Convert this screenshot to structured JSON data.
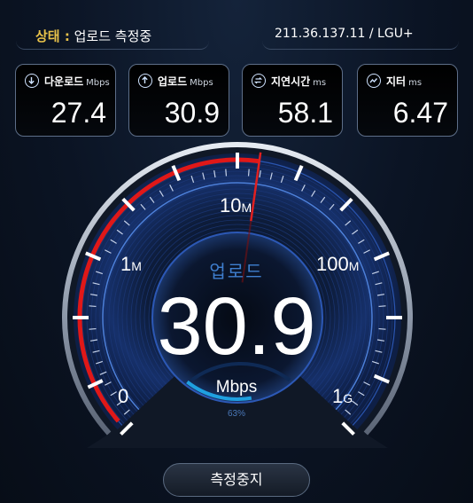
{
  "status": {
    "label": "상태 :",
    "text": "업로드 측정중"
  },
  "connection": {
    "ip_isp": "211.36.137.11 / LGU+"
  },
  "cards": [
    {
      "title": "다운로드",
      "unit": "Mbps",
      "value": "27.4",
      "icon": "download-icon"
    },
    {
      "title": "업로드",
      "unit": "Mbps",
      "value": "30.9",
      "icon": "upload-icon"
    },
    {
      "title": "지연시간",
      "unit": "ms",
      "value": "58.1",
      "icon": "latency-icon"
    },
    {
      "title": "지터",
      "unit": "ms",
      "value": "6.47",
      "icon": "jitter-icon"
    }
  ],
  "gauge": {
    "mode": "업로드",
    "speed": "30.9",
    "speed_unit": "Mbps",
    "progress_text": "63%",
    "progress": 0.63,
    "labels": {
      "l0": "0",
      "l1m_num": "1",
      "l1m_suf": "M",
      "l10m_num": "10",
      "l10m_suf": "M",
      "l100m_num": "100",
      "l100m_suf": "M",
      "l1g_num": "1",
      "l1g_suf": "G"
    },
    "colors": {
      "needle": "#e02020",
      "arc": "#e01818",
      "progress": "#1fa0e0"
    }
  },
  "stop_button": {
    "label": "측정중지"
  }
}
